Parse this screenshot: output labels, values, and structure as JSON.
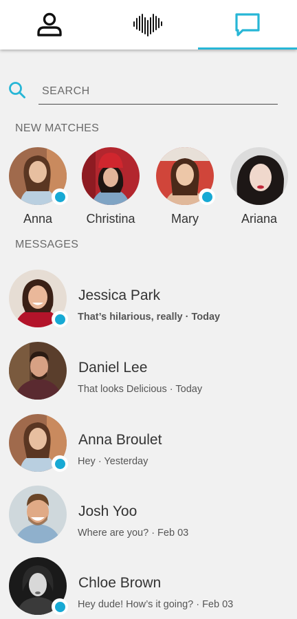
{
  "nav": {
    "tabs": [
      {
        "icon": "profile-icon",
        "active": false
      },
      {
        "icon": "heartbeat-logo-icon",
        "active": false
      },
      {
        "icon": "chat-icon",
        "active": true
      }
    ],
    "accent": "#27b6d6"
  },
  "search": {
    "placeholder": "SEARCH",
    "value": ""
  },
  "new_matches": {
    "label": "NEW MATCHES",
    "items": [
      {
        "name": "Anna",
        "online": true
      },
      {
        "name": "Christina",
        "online": false
      },
      {
        "name": "Mary",
        "online": true
      },
      {
        "name": "Ariana",
        "online": false
      }
    ]
  },
  "messages": {
    "label": "MESSAGES",
    "items": [
      {
        "name": "Jessica Park",
        "preview": "That’s hilarious, really · Today",
        "unread": true,
        "online": true
      },
      {
        "name": "Daniel Lee",
        "preview": "That looks Delicious · Today",
        "unread": false,
        "online": false
      },
      {
        "name": "Anna Broulet",
        "preview": "Hey · Yesterday",
        "unread": false,
        "online": true
      },
      {
        "name": "Josh Yoo",
        "preview": "Where are you? · Feb 03",
        "unread": false,
        "online": false
      },
      {
        "name": "Chloe Brown",
        "preview": "Hey dude! How’s it going? · Feb 03",
        "unread": false,
        "online": true
      }
    ]
  },
  "colors": {
    "online_dot": "#17a9d4",
    "background": "#f1f1f1"
  }
}
